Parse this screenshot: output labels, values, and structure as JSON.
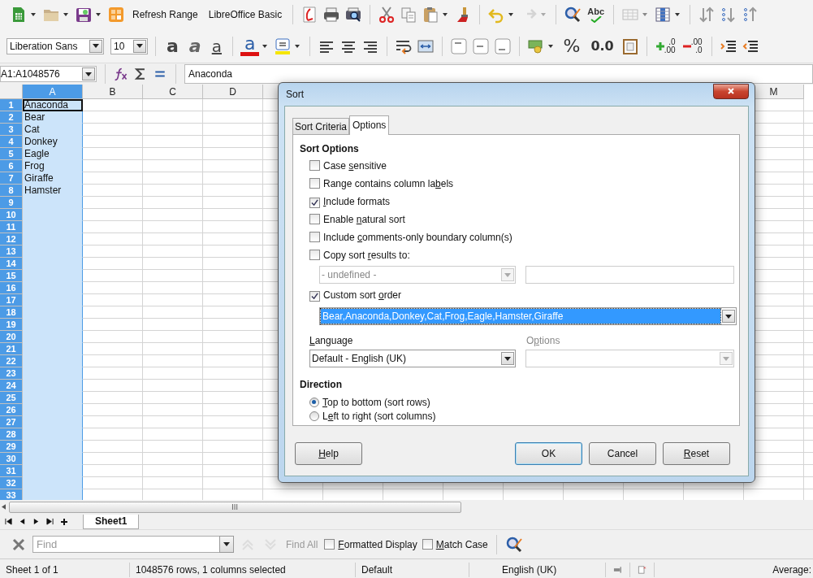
{
  "toolbar": {
    "refresh_range": "Refresh Range",
    "basic": "LibreOffice Basic",
    "spelling": "Abc",
    "redo": {
      "disabled": true
    }
  },
  "format_bar": {
    "font": "Liberation Sans",
    "size": "10",
    "bold": "a",
    "italic": "a",
    "underline": "a",
    "font_color": "a",
    "percent": "%",
    "number": "0.0",
    "add_decimal": [
      ".0",
      ".00"
    ],
    "delete_decimal": [
      ".00",
      ".0"
    ]
  },
  "formula_bar": {
    "name_box": "A1:A1048576",
    "content": "Anaconda"
  },
  "sheet": {
    "columns": [
      {
        "label": "A",
        "selected": true
      },
      {
        "label": "B",
        "selected": false
      },
      {
        "label": "C",
        "selected": false
      },
      {
        "label": "D",
        "selected": false
      },
      {
        "selected": false
      },
      {
        "label": "M",
        "selected": false
      }
    ],
    "rows": [
      {
        "number": "1",
        "selected": true,
        "cells": [
          {
            "text": "Anaconda",
            "active": true
          }
        ]
      },
      {
        "number": "2",
        "selected": true,
        "cells": [
          {
            "text": "Bear",
            "active": false
          }
        ]
      },
      {
        "number": "3",
        "selected": true,
        "cells": [
          {
            "text": "Cat",
            "active": false
          }
        ]
      },
      {
        "number": "4",
        "selected": true,
        "cells": [
          {
            "text": "Donkey",
            "active": false
          }
        ]
      },
      {
        "number": "5",
        "selected": true,
        "cells": [
          {
            "text": "Eagle",
            "active": false
          }
        ]
      },
      {
        "number": "6",
        "selected": true,
        "cells": [
          {
            "text": "Frog",
            "active": false
          }
        ]
      },
      {
        "number": "7",
        "selected": true,
        "cells": [
          {
            "text": "Giraffe",
            "active": false
          }
        ]
      },
      {
        "number": "8",
        "selected": true,
        "cells": [
          {
            "text": "Hamster",
            "active": false
          }
        ]
      },
      {
        "number": "9",
        "selected": true
      },
      {
        "number": "10",
        "selected": true
      },
      {
        "number": "11",
        "selected": true
      },
      {
        "number": "12",
        "selected": true
      },
      {
        "number": "13",
        "selected": true
      },
      {
        "number": "14",
        "selected": true
      },
      {
        "number": "15",
        "selected": true
      },
      {
        "number": "16",
        "selected": true
      },
      {
        "number": "17",
        "selected": true
      },
      {
        "number": "18",
        "selected": true
      },
      {
        "number": "19",
        "selected": true
      },
      {
        "number": "20",
        "selected": true
      },
      {
        "number": "21",
        "selected": true
      },
      {
        "number": "22",
        "selected": true
      },
      {
        "number": "23",
        "selected": true
      },
      {
        "number": "24",
        "selected": true
      },
      {
        "number": "25",
        "selected": true
      },
      {
        "number": "26",
        "selected": true
      },
      {
        "number": "27",
        "selected": true
      },
      {
        "number": "28",
        "selected": true
      },
      {
        "number": "29",
        "selected": true
      },
      {
        "number": "30",
        "selected": true
      },
      {
        "number": "31",
        "selected": true
      },
      {
        "number": "32",
        "selected": true
      },
      {
        "number": "33",
        "selected": true
      }
    ]
  },
  "dialog": {
    "title": "Sort",
    "tabs": [
      {
        "label": "Sort Criteria",
        "selected": false
      },
      {
        "label": "Options",
        "selected": true
      }
    ],
    "sort_options_heading": "Sort Options",
    "options": [
      {
        "label": {
          "pre": "Case ",
          "key": "s",
          "post": "ensitive"
        },
        "checked": false
      },
      {
        "label": {
          "pre": "Range contains column la",
          "key": "b",
          "post": "els"
        },
        "checked": false
      },
      {
        "label": {
          "key": "I",
          "post": "nclude formats"
        },
        "checked": true
      },
      {
        "label": {
          "pre": "Enable ",
          "key": "n",
          "post": "atural sort"
        },
        "checked": false
      },
      {
        "label": {
          "pre": "Include ",
          "key": "c",
          "post": "omments-only boundary column(s)"
        },
        "checked": false
      },
      {
        "label": {
          "pre": "Copy sort ",
          "key": "r",
          "post": "esults to:"
        },
        "checked": false
      }
    ],
    "copy_target": {
      "value": "- undefined -",
      "disabled": true
    },
    "custom_order": {
      "label": {
        "pre": "Custom sort ",
        "key": "o",
        "post": "rder"
      },
      "checked": true,
      "value": "Bear,Anaconda,Donkey,Cat,Frog,Eagle,Hamster,Giraffe"
    },
    "language": {
      "label": {
        "key": "L",
        "post": "anguage"
      },
      "value": "Default - English (UK)"
    },
    "language_options": {
      "label": {
        "pre": "O",
        "key": "p",
        "post": "tions"
      },
      "disabled": true
    },
    "direction_heading": "Direction",
    "direction": [
      {
        "label": {
          "key": "T",
          "post": "op to bottom (sort rows)"
        },
        "selected": true
      },
      {
        "label": {
          "pre": "L",
          "key": "e",
          "post": "ft to right (sort columns)"
        },
        "selected": false
      }
    ],
    "buttons": [
      {
        "label": {
          "key": "H",
          "post": "elp"
        },
        "default": false
      },
      {
        "label": {
          "pre": "OK"
        },
        "default": true
      },
      {
        "label": {
          "pre": "Cancel"
        },
        "default": false
      },
      {
        "label": {
          "key": "R",
          "post": "eset"
        },
        "default": false
      }
    ]
  },
  "sheet_tabs": [
    {
      "label": "Sheet1",
      "selected": true
    }
  ],
  "find_bar": {
    "placeholder": "Find",
    "find_all": "Find All",
    "options": [
      {
        "label": {
          "key": "F",
          "post": "ormatted Display"
        },
        "checked": false
      },
      {
        "label": {
          "key": "M",
          "post": "atch Case"
        },
        "checked": false
      }
    ]
  },
  "status_bar": {
    "sheet": "Sheet 1 of 1",
    "selection": "1048576 rows, 1 columns selected",
    "page_style": "Default",
    "language": "English (UK)",
    "sum": "Average:"
  }
}
